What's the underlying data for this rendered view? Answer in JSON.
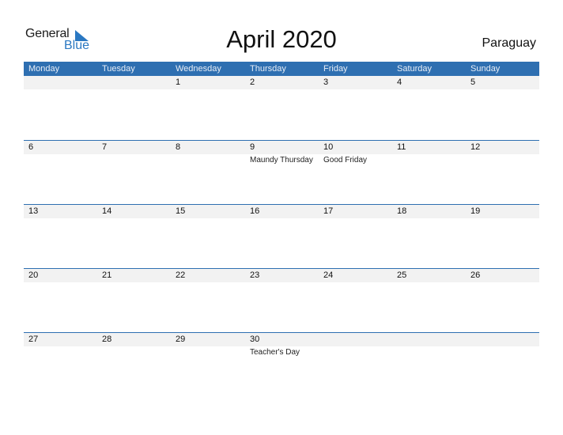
{
  "brand": {
    "word1": "General",
    "word2": "Blue",
    "accent": "#2a78c2"
  },
  "title": "April 2020",
  "country": "Paraguay",
  "colors": {
    "header_bg": "#2e6fb1",
    "day_strip": "#f2f2f2"
  },
  "weekdays": [
    "Monday",
    "Tuesday",
    "Wednesday",
    "Thursday",
    "Friday",
    "Saturday",
    "Sunday"
  ],
  "weeks": [
    [
      {
        "day": ""
      },
      {
        "day": ""
      },
      {
        "day": "1"
      },
      {
        "day": "2"
      },
      {
        "day": "3"
      },
      {
        "day": "4"
      },
      {
        "day": "5"
      }
    ],
    [
      {
        "day": "6"
      },
      {
        "day": "7"
      },
      {
        "day": "8"
      },
      {
        "day": "9",
        "holiday": "Maundy Thursday"
      },
      {
        "day": "10",
        "holiday": "Good Friday"
      },
      {
        "day": "11"
      },
      {
        "day": "12"
      }
    ],
    [
      {
        "day": "13"
      },
      {
        "day": "14"
      },
      {
        "day": "15"
      },
      {
        "day": "16"
      },
      {
        "day": "17"
      },
      {
        "day": "18"
      },
      {
        "day": "19"
      }
    ],
    [
      {
        "day": "20"
      },
      {
        "day": "21"
      },
      {
        "day": "22"
      },
      {
        "day": "23"
      },
      {
        "day": "24"
      },
      {
        "day": "25"
      },
      {
        "day": "26"
      }
    ],
    [
      {
        "day": "27"
      },
      {
        "day": "28"
      },
      {
        "day": "29"
      },
      {
        "day": "30",
        "holiday": "Teacher's Day"
      },
      {
        "day": ""
      },
      {
        "day": ""
      },
      {
        "day": ""
      }
    ]
  ]
}
